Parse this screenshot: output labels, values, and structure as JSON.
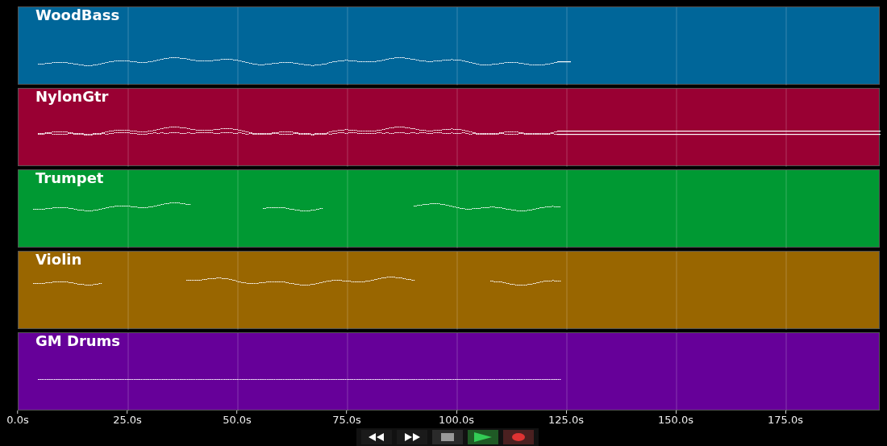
{
  "tracks": [
    {
      "name": "WoodBass",
      "color": "#006699"
    },
    {
      "name": "NylonGtr",
      "color": "#990033"
    },
    {
      "name": "Trumpet",
      "color": "#009933"
    },
    {
      "name": "Violin",
      "color": "#996600"
    },
    {
      "name": "GM Drums",
      "color": "#660099"
    }
  ],
  "time_axis": {
    "ticks": [
      "0.0s",
      "25.0s",
      "50.0s",
      "75.0s",
      "100.0s",
      "125.0s",
      "150.0s",
      "175.0s"
    ]
  },
  "transport": [
    {
      "kind": "rewind"
    },
    {
      "kind": "forward"
    },
    {
      "kind": "stop"
    },
    {
      "kind": "play"
    },
    {
      "kind": "record"
    }
  ]
}
